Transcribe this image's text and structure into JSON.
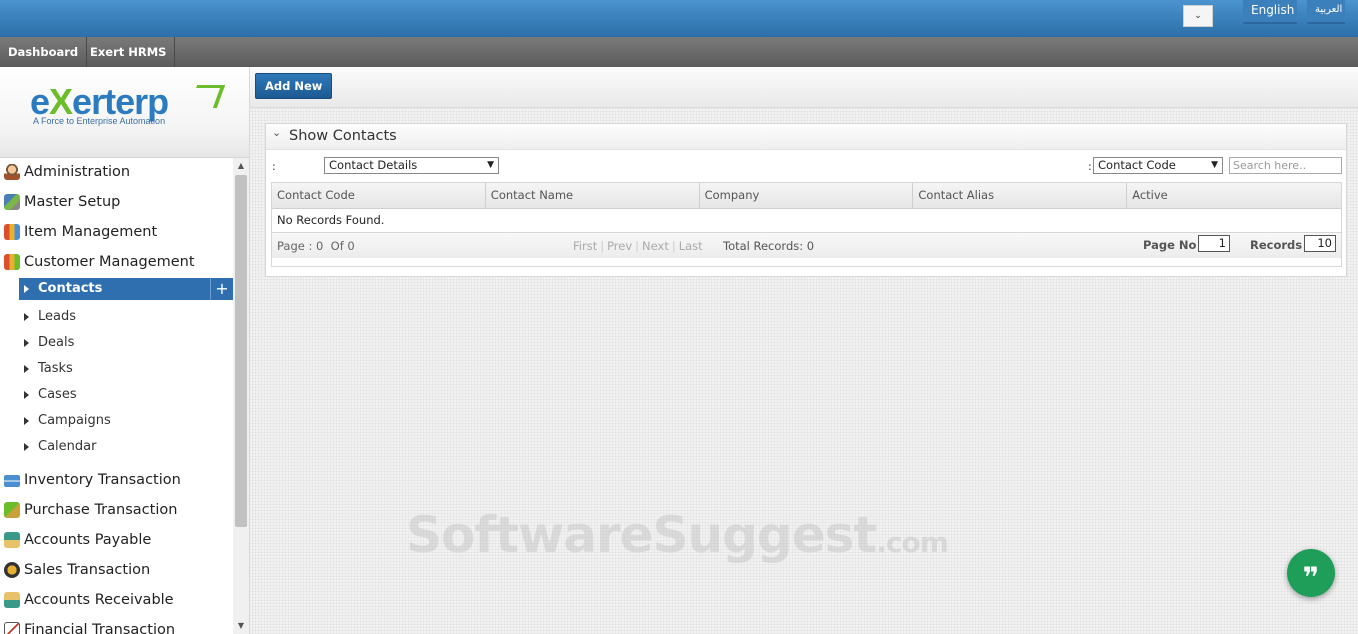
{
  "topbar": {
    "language_dropdown_icon": "chevron-down",
    "english_label": "English",
    "arabic_label": "العربية"
  },
  "navbar": {
    "items": [
      "Dashboard",
      "Exert HRMS"
    ]
  },
  "logo": {
    "word_start": "e",
    "word_x": "X",
    "word_end": "erterp",
    "tagline": "A Force to Enterprise Automation"
  },
  "sidebar": {
    "menu_top": [
      {
        "label": "Administration",
        "icon": "admin-icon"
      },
      {
        "label": "Master Setup",
        "icon": "setup-icon"
      },
      {
        "label": "Item Management",
        "icon": "items-icon"
      },
      {
        "label": "Customer Management",
        "icon": "customer-icon"
      }
    ],
    "submenu": [
      {
        "label": "Contacts",
        "active": true
      },
      {
        "label": "Leads"
      },
      {
        "label": "Deals"
      },
      {
        "label": "Tasks"
      },
      {
        "label": "Cases"
      },
      {
        "label": "Campaigns"
      },
      {
        "label": "Calendar"
      }
    ],
    "submenu_add": "+",
    "menu_bottom": [
      {
        "label": "Inventory Transaction",
        "icon": "inventory-icon"
      },
      {
        "label": "Purchase Transaction",
        "icon": "purchase-icon"
      },
      {
        "label": "Accounts Payable",
        "icon": "payable-icon"
      },
      {
        "label": "Sales Transaction",
        "icon": "sales-icon"
      },
      {
        "label": "Accounts Receivable",
        "icon": "receivable-icon"
      },
      {
        "label": "Financial Transaction",
        "icon": "financial-icon"
      }
    ]
  },
  "toolbar": {
    "add_new_label": "Add New"
  },
  "panel": {
    "title": "Show Contacts",
    "filter_colon": ":",
    "view_select": "Contact Details",
    "search_field_select": "Contact Code",
    "search_placeholder": "Search here.."
  },
  "grid": {
    "columns": [
      "Contact Code",
      "Contact Name",
      "Company",
      "Contact Alias",
      "Active"
    ],
    "empty_message": "No Records Found.",
    "footer": {
      "page_label": "Page : 0",
      "of_label": "Of 0",
      "first": "First",
      "prev": "Prev",
      "next": "Next",
      "last": "Last",
      "total_records": "Total Records: 0",
      "page_no_label": "Page No",
      "page_no_value": "1",
      "records_label": "Records",
      "records_value": "10"
    }
  },
  "watermark": {
    "main": "SoftwareSuggest",
    "suffix": ".com"
  },
  "chat": {
    "glyph": "❞"
  }
}
